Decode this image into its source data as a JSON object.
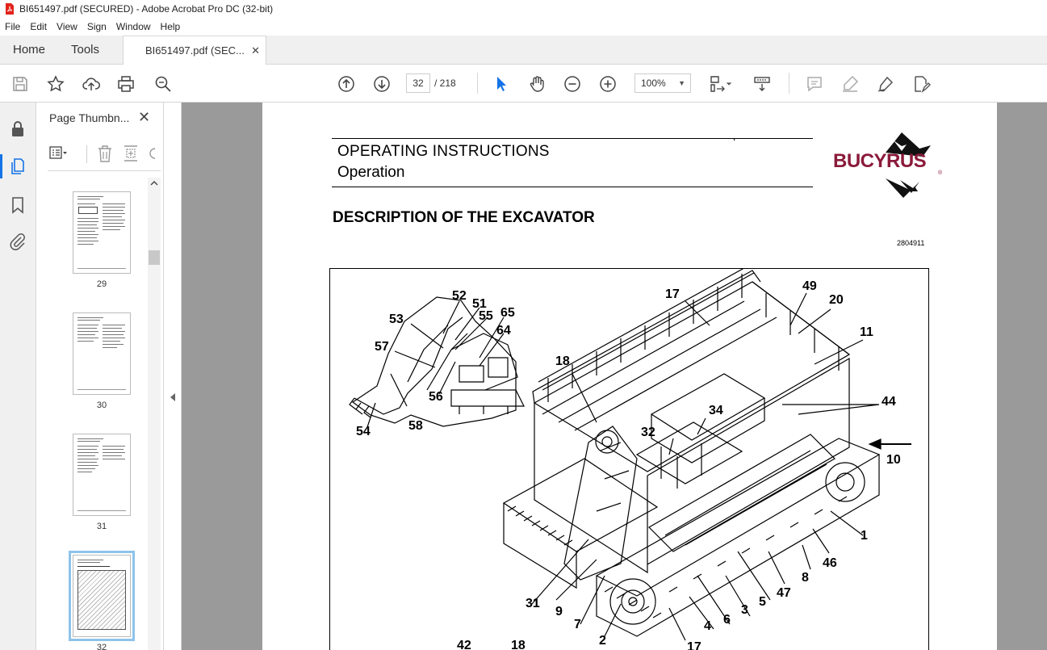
{
  "window": {
    "title": "BI651497.pdf (SECURED) - Adobe Acrobat Pro DC (32-bit)"
  },
  "menu": [
    "File",
    "Edit",
    "View",
    "Sign",
    "Window",
    "Help"
  ],
  "tabs": {
    "home": "Home",
    "tools": "Tools",
    "document": "BI651497.pdf (SEC...",
    "close": "✕"
  },
  "toolbar": {
    "current_page": "32",
    "page_total": "/ 218",
    "zoom": "100%"
  },
  "thumbnails": {
    "title": "Page Thumbn...",
    "close": "✕",
    "pages": [
      {
        "label": "29"
      },
      {
        "label": "30"
      },
      {
        "label": "31"
      },
      {
        "label": "32",
        "selected": true
      }
    ]
  },
  "document": {
    "header_title": "OPERATING INSTRUCTIONS",
    "header_subtitle": "Operation",
    "brand": "BUCYRUS",
    "brand_reg": "®",
    "section_title": "DESCRIPTION OF THE EXCAVATOR",
    "figure_number": "2804911",
    "callouts": [
      "17",
      "49",
      "20",
      "11",
      "18",
      "44",
      "34",
      "32",
      "10",
      "1",
      "46",
      "8",
      "47",
      "5",
      "3",
      "6",
      "4",
      "2",
      "7",
      "9",
      "31",
      "52",
      "51",
      "55",
      "65",
      "64",
      "53",
      "57",
      "56",
      "54",
      "58",
      "42",
      "18",
      "17"
    ]
  },
  "colors": {
    "brand": "#8b1a3a",
    "accent": "#1473e6",
    "viewer_bg": "#9a9a9a"
  }
}
